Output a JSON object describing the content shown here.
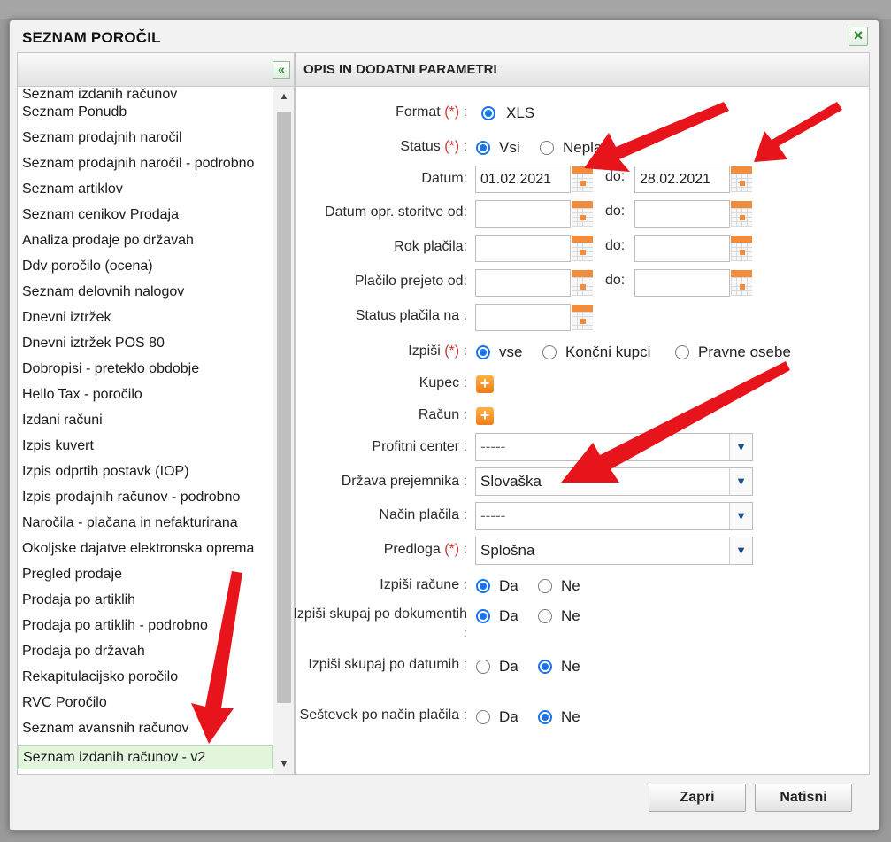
{
  "dialog": {
    "title": "SEZNAM POROČIL",
    "close_icon": "close-icon",
    "close_label": "×"
  },
  "left_panel": {
    "collapse_label": "«",
    "reports": [
      "Seznam izdanih računov",
      "Seznam Ponudb",
      "Seznam prodajnih naročil",
      "Seznam prodajnih naročil - podrobno",
      "Seznam artiklov",
      "Seznam cenikov Prodaja",
      "Analiza prodaje po državah",
      "Ddv poročilo (ocena)",
      "Seznam delovnih nalogov",
      "Dnevni iztržek",
      "Dnevni iztržek POS 80",
      "Dobropisi - preteklo obdobje",
      "Hello Tax - poročilo",
      "Izdani računi",
      "Izpis kuvert",
      "Izpis odprtih postavk (IOP)",
      "Izpis prodajnih računov - podrobno",
      "Naročila - plačana in nefakturirana",
      "Okoljske dajatve elektronska oprema",
      "Pregled prodaje",
      "Prodaja po artiklih",
      "Prodaja po artiklih - podrobno",
      "Prodaja po državah",
      "Rekapitulacijsko poročilo",
      "RVC Poročilo",
      "Seznam avansnih računov",
      "Seznam izdanih računov - v2"
    ],
    "selected_index": 26,
    "scroll_up": "▲",
    "scroll_down": "▼"
  },
  "right_panel": {
    "header": "OPIS IN DODATNI PARAMETRI",
    "format": {
      "label": "Format",
      "req": "(*)",
      "colon": ":",
      "option": "XLS"
    },
    "status": {
      "label": "Status",
      "req": "(*)",
      "colon": ":",
      "opt1": "Vsi",
      "opt2": "Neplač"
    },
    "datum": {
      "label": "Datum:",
      "from": "01.02.2021",
      "do": "do:",
      "to": "28.02.2021"
    },
    "datum_opr": {
      "label": "Datum opr. storitve od:",
      "do": "do:"
    },
    "rok": {
      "label": "Rok plačila:",
      "do": "do:"
    },
    "placilo": {
      "label": "Plačilo prejeto od:",
      "do": "do:"
    },
    "status_placila": {
      "label": "Status plačila na :"
    },
    "izpisi": {
      "label": "Izpiši",
      "req": "(*)",
      "colon": ":",
      "opt1": "vse",
      "opt2": "Končni kupci",
      "opt3": "Pravne osebe"
    },
    "kupec": {
      "label": "Kupec :",
      "btn": "+"
    },
    "racun": {
      "label": "Račun :",
      "btn": "+"
    },
    "profitni": {
      "label": "Profitni center :",
      "value": "-----"
    },
    "drzava": {
      "label": "Država prejemnika :",
      "value": "Slovaška"
    },
    "nacin": {
      "label": "Način plačila :",
      "value": "-----"
    },
    "predloga": {
      "label": "Predloga",
      "req": "(*)",
      "colon": ":",
      "value": "Splošna"
    },
    "izpisi_racune": {
      "label": "Izpiši račune :",
      "da": "Da",
      "ne": "Ne"
    },
    "skupaj_dok": {
      "label": "Izpiši skupaj po dokumentih :",
      "da": "Da",
      "ne": "Ne"
    },
    "skupaj_dat": {
      "label": "Izpiši skupaj po datumih :",
      "da": "Da",
      "ne": "Ne"
    },
    "sestevek": {
      "label": "Seštevek po način plačila :",
      "da": "Da",
      "ne": "Ne"
    },
    "select_arrow": "▼"
  },
  "buttons": {
    "close": "Zapri",
    "print": "Natisni"
  },
  "colors": {
    "accent": "#1a73e8",
    "annotation": "#e8141b",
    "selected_row": "#e4f5de"
  }
}
